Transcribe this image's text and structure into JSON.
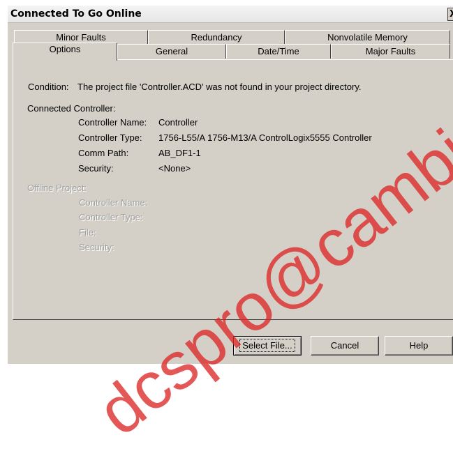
{
  "window": {
    "title": "Connected To Go Online",
    "close_glyph": "X"
  },
  "tabs_back": [
    "Minor Faults",
    "Redundancy",
    "Nonvolatile Memory"
  ],
  "tabs_front": [
    "Options",
    "General",
    "Date/Time",
    "Major Faults"
  ],
  "active_tab": "Options",
  "condition": {
    "label": "Condition:",
    "text": "The project file 'Controller.ACD' was not found in your project directory."
  },
  "connected": {
    "heading": "Connected Controller:",
    "name_label": "Controller Name:",
    "name_value": "Controller",
    "type_label": "Controller Type:",
    "type_value": "1756-L55/A 1756-M13/A ControlLogix5555 Controller",
    "path_label": "Comm Path:",
    "path_value": "AB_DF1-1",
    "security_label": "Security:",
    "security_value": "<None>"
  },
  "offline": {
    "heading": "Offline Project:",
    "name_label": "Controller Name:",
    "type_label": "Controller Type:",
    "file_label": "File:",
    "security_label": "Security:"
  },
  "buttons": {
    "select_file": "Select File...",
    "cancel": "Cancel",
    "help": "Help"
  },
  "watermark": "dcspro@cambia"
}
